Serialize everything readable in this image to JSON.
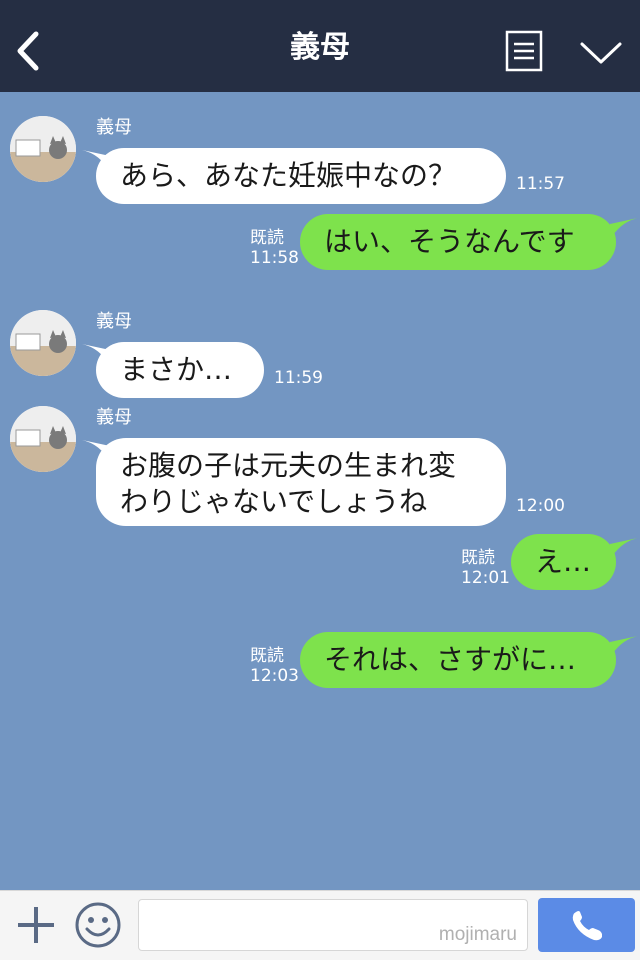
{
  "header": {
    "title": "義母"
  },
  "messages": [
    {
      "side": "in",
      "sender": "義母",
      "text": "あら、あなた妊娠中なの？",
      "time": "11:57"
    },
    {
      "side": "out",
      "read": "既読",
      "text": "はい、そうなんです",
      "time": "11:58"
    },
    {
      "side": "in",
      "sender": "義母",
      "text": "まさか…",
      "time": "11:59"
    },
    {
      "side": "in",
      "sender": "義母",
      "text": "お腹の子は元夫の生まれ変わりじゃないでしょうね",
      "time": "12:00"
    },
    {
      "side": "out",
      "read": "既読",
      "text": "え…",
      "time": "12:01"
    },
    {
      "side": "out",
      "read": "既読",
      "text": "それは、さすがに…",
      "time": "12:03"
    }
  ],
  "footer": {
    "watermark": "mojimaru"
  },
  "colors": {
    "header_bg": "#252e43",
    "chat_bg": "#7396c2",
    "incoming_bubble": "#ffffff",
    "outgoing_bubble": "#7ee24c",
    "call_button": "#5b8be6"
  },
  "icons": {
    "back": "chevron-left-icon",
    "menu": "document-list-icon",
    "collapse": "chevron-down-icon",
    "add": "plus-icon",
    "emoji": "smiley-icon",
    "call": "phone-icon"
  }
}
